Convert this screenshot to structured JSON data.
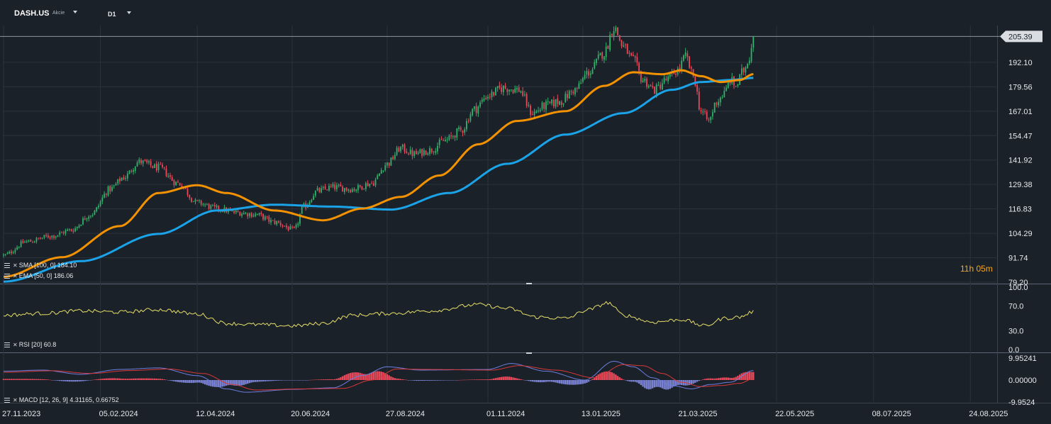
{
  "header": {
    "symbol": "DASH.US",
    "instrument_type": "Akcie",
    "timeframe": "D1"
  },
  "countdown": {
    "hours": "11h",
    "minutes": "05m"
  },
  "colors": {
    "background": "#1b2128",
    "grid": "#2a323c",
    "up": "#2fb36b",
    "down": "#e8495a",
    "sma": "#1aa3e8",
    "ema": "#f39200",
    "rsi": "#e6de6a",
    "macd_line": "#6b7fe0",
    "signal_line": "#d83838",
    "hist_pos": "#e8495a",
    "hist_neg": "#7b82d4",
    "axis_text": "#e6e9ee",
    "price_badge": "#d9dde2"
  },
  "legends": {
    "sma": "SMA [100, 0] 184.10",
    "ema": "EMA [50, 0] 186.06",
    "rsi": "RSI [20] 60.8",
    "macd": "MACD [12, 26, 9] 4.31165, 0.66752"
  },
  "chart_data": [
    {
      "type": "line",
      "panel": "price",
      "title": "DASH.US",
      "ylim": [
        79.2,
        211
      ],
      "y_ticks": [
        "192.10",
        "179.56",
        "167.01",
        "154.47",
        "141.92",
        "129.38",
        "116.83",
        "104.29",
        "91.74",
        "79.20"
      ],
      "current_price": "205.39",
      "x_ticks": [
        "27.11.2023",
        "05.02.2024",
        "12.04.2024",
        "20.06.2024",
        "27.08.2024",
        "01.11.2024",
        "13.01.2025",
        "21.03.2025",
        "22.05.2025",
        "08.07.2025",
        "24.08.2025"
      ],
      "x_tick_index": [
        0,
        50,
        100,
        149,
        198,
        250,
        299,
        349,
        399,
        449,
        499
      ],
      "close_keypoints": [
        [
          0,
          93
        ],
        [
          12,
          100
        ],
        [
          25,
          103
        ],
        [
          35,
          106
        ],
        [
          45,
          114
        ],
        [
          55,
          127
        ],
        [
          62,
          133
        ],
        [
          70,
          141
        ],
        [
          80,
          138
        ],
        [
          90,
          130
        ],
        [
          100,
          120
        ],
        [
          110,
          117
        ],
        [
          120,
          115
        ],
        [
          130,
          114
        ],
        [
          140,
          110
        ],
        [
          150,
          106
        ],
        [
          155,
          118
        ],
        [
          162,
          126
        ],
        [
          170,
          128
        ],
        [
          180,
          127
        ],
        [
          190,
          130
        ],
        [
          198,
          140
        ],
        [
          205,
          148
        ],
        [
          212,
          145
        ],
        [
          220,
          147
        ],
        [
          228,
          152
        ],
        [
          236,
          157
        ],
        [
          243,
          168
        ],
        [
          250,
          175
        ],
        [
          258,
          179
        ],
        [
          266,
          178
        ],
        [
          273,
          166
        ],
        [
          280,
          170
        ],
        [
          287,
          172
        ],
        [
          295,
          178
        ],
        [
          302,
          187
        ],
        [
          310,
          197
        ],
        [
          315,
          210
        ],
        [
          320,
          200
        ],
        [
          325,
          193
        ],
        [
          330,
          183
        ],
        [
          336,
          178
        ],
        [
          342,
          183
        ],
        [
          348,
          188
        ],
        [
          352,
          195
        ],
        [
          356,
          185
        ],
        [
          360,
          167
        ],
        [
          364,
          162
        ],
        [
          368,
          172
        ],
        [
          372,
          176
        ],
        [
          375,
          183
        ],
        [
          378,
          180
        ],
        [
          382,
          188
        ],
        [
          385,
          195
        ],
        [
          387,
          205.39
        ]
      ],
      "series": [
        {
          "name": "SMA [100, 0] 184.10",
          "keypoints": [
            [
              0,
              79.5
            ],
            [
              40,
              90
            ],
            [
              80,
              104
            ],
            [
              110,
              116
            ],
            [
              140,
              119
            ],
            [
              170,
              118
            ],
            [
              200,
              116.5
            ],
            [
              230,
              125
            ],
            [
              260,
              140
            ],
            [
              290,
              155
            ],
            [
              320,
              166
            ],
            [
              345,
              178
            ],
            [
              360,
              182
            ],
            [
              375,
              183
            ],
            [
              387,
              184.1
            ]
          ]
        },
        {
          "name": "EMA [50, 0] 186.06",
          "keypoints": [
            [
              0,
              82
            ],
            [
              30,
              92
            ],
            [
              60,
              108
            ],
            [
              80,
              125
            ],
            [
              100,
              129
            ],
            [
              115,
              125
            ],
            [
              140,
              116
            ],
            [
              165,
              111
            ],
            [
              185,
              117
            ],
            [
              205,
              123
            ],
            [
              225,
              134
            ],
            [
              245,
              150
            ],
            [
              265,
              162
            ],
            [
              290,
              167
            ],
            [
              310,
              180
            ],
            [
              325,
              187
            ],
            [
              340,
              186
            ],
            [
              350,
              188
            ],
            [
              360,
              185
            ],
            [
              370,
              182
            ],
            [
              380,
              183
            ],
            [
              387,
              186.06
            ]
          ]
        }
      ]
    },
    {
      "type": "line",
      "panel": "rsi",
      "title": "RSI [20] 60.8",
      "ylim": [
        0,
        100
      ],
      "y_ticks": [
        "100.0",
        "70.0",
        "30.0",
        "0.0"
      ],
      "series": [
        {
          "name": "RSI [20] 60.8",
          "keypoints": [
            [
              0,
              55
            ],
            [
              20,
              58
            ],
            [
              40,
              62
            ],
            [
              60,
              60
            ],
            [
              80,
              64
            ],
            [
              100,
              57
            ],
            [
              115,
              42
            ],
            [
              130,
              40
            ],
            [
              150,
              38
            ],
            [
              165,
              42
            ],
            [
              180,
              55
            ],
            [
              200,
              58
            ],
            [
              220,
              62
            ],
            [
              245,
              72
            ],
            [
              260,
              66
            ],
            [
              275,
              52
            ],
            [
              290,
              50
            ],
            [
              302,
              64
            ],
            [
              312,
              75
            ],
            [
              320,
              55
            ],
            [
              335,
              44
            ],
            [
              350,
              48
            ],
            [
              362,
              38
            ],
            [
              372,
              50
            ],
            [
              380,
              52
            ],
            [
              387,
              60.8
            ]
          ]
        }
      ]
    },
    {
      "type": "bar",
      "panel": "macd",
      "title": "MACD [12, 26, 9] 4.31165, 0.66752",
      "ylim": [
        -9.9524,
        9.95241
      ],
      "y_ticks": [
        "9.95241",
        "0.00000",
        "-9.9524"
      ],
      "series": [
        {
          "name": "MACD [12, 26, 9] 4.31165, 0.66752",
          "keypoints": [
            [
              0,
              4
            ],
            [
              20,
              4.5
            ],
            [
              40,
              2.6
            ],
            [
              60,
              4.8
            ],
            [
              80,
              5.5
            ],
            [
              100,
              2
            ],
            [
              115,
              -4
            ],
            [
              125,
              -5.5
            ],
            [
              150,
              -4.2
            ],
            [
              170,
              -3.5
            ],
            [
              185,
              2
            ],
            [
              198,
              6
            ],
            [
              215,
              4.5
            ],
            [
              250,
              4.8
            ],
            [
              262,
              7.5
            ],
            [
              280,
              4
            ],
            [
              300,
              0
            ],
            [
              315,
              8.5
            ],
            [
              325,
              6
            ],
            [
              335,
              1
            ],
            [
              345,
              -2.5
            ],
            [
              355,
              -4
            ],
            [
              365,
              -2
            ],
            [
              375,
              -1
            ],
            [
              387,
              4.31165
            ]
          ]
        },
        {
          "name": "Signal",
          "keypoints": [
            [
              0,
              3.5
            ],
            [
              25,
              4.2
            ],
            [
              45,
              3
            ],
            [
              65,
              4.3
            ],
            [
              85,
              5
            ],
            [
              103,
              3
            ],
            [
              118,
              -2
            ],
            [
              130,
              -4.5
            ],
            [
              155,
              -4
            ],
            [
              175,
              -3.8
            ],
            [
              190,
              0
            ],
            [
              203,
              5
            ],
            [
              220,
              4.8
            ],
            [
              252,
              4.5
            ],
            [
              266,
              6.5
            ],
            [
              285,
              4.5
            ],
            [
              305,
              1
            ],
            [
              320,
              7
            ],
            [
              330,
              6.5
            ],
            [
              340,
              3
            ],
            [
              350,
              -1
            ],
            [
              360,
              -3
            ],
            [
              370,
              -2.5
            ],
            [
              380,
              -1.5
            ],
            [
              387,
              0.66752
            ]
          ]
        }
      ]
    }
  ]
}
